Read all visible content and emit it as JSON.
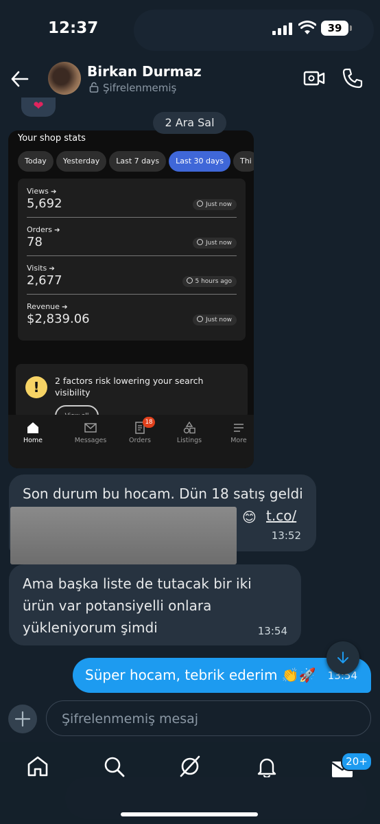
{
  "status_bar": {
    "time": "12:37",
    "battery": "39"
  },
  "header": {
    "contact_name": "Birkan Durmaz",
    "encryption_status": "Şifrelenmemiş"
  },
  "chat": {
    "date_pill": "2 Ara Sal",
    "shared_screenshot": {
      "title": "Your shop stats",
      "chips": [
        "Today",
        "Yesterday",
        "Last 7 days",
        "Last 30 days",
        "Thi"
      ],
      "active_chip": "Last 30 days",
      "stats": [
        {
          "label": "Views",
          "value": "5,692",
          "updated": "Just now"
        },
        {
          "label": "Orders",
          "value": "78",
          "updated": "Just now"
        },
        {
          "label": "Visits",
          "value": "2,677",
          "updated": "5 hours ago"
        },
        {
          "label": "Revenue",
          "value": "$2,839.06",
          "updated": "Just now"
        }
      ],
      "risk_notice": "2 factors risk lowering your search visibility",
      "risk_button": "View all",
      "tabs": [
        "Home",
        "Messages",
        "Orders",
        "Listings",
        "More"
      ],
      "orders_badge": "18"
    },
    "messages": [
      {
        "text": "Son durum bu hocam. Dün 18 satış geldi",
        "emoji": "😊",
        "link": "t.co/",
        "time": "13:52",
        "sender": "them"
      },
      {
        "text": "Ama başka liste de tutacak bir iki ürün var potansiyelli onlara yükleniyorum şimdi",
        "time": "13:54",
        "sender": "them"
      },
      {
        "text": "Süper hocam, tebrik ederim 👏🚀",
        "time": "13:54",
        "sender": "me"
      }
    ]
  },
  "composer": {
    "placeholder": "Şifrelenmemiş mesaj"
  },
  "bottom_nav": {
    "messages_badge": "20+"
  },
  "colors": {
    "background": "#15202b",
    "bubble_them": "#273340",
    "bubble_me": "#1d9bf0",
    "accent_chip": "#3f67d8"
  }
}
